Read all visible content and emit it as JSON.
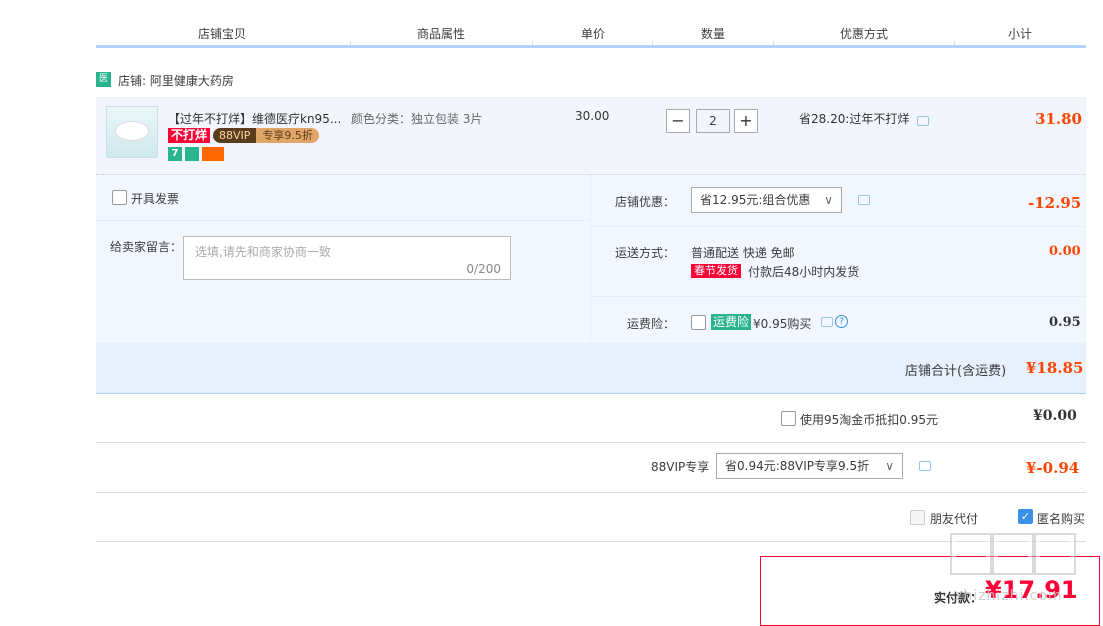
{
  "table_header": {
    "columns": [
      "店铺宝贝",
      "商品属性",
      "单价",
      "数量",
      "优惠方式",
      "小计"
    ]
  },
  "shop": {
    "icon_text": "医",
    "label": "店铺:",
    "name": "阿里健康大药房"
  },
  "item": {
    "title": "【过年不打烊】维德医疗kn95...",
    "badge_not_closed": "不打烊",
    "badge_vip": "88VIP",
    "badge_vip_discount": "专享9.5折",
    "attribute": "颜色分类：独立包装 3片",
    "unit_price": "30.00",
    "quantity": "2",
    "discount_text": "省28.20:过年不打烊",
    "subtotal": "31.80"
  },
  "invoice": {
    "label": "开具发票"
  },
  "message": {
    "label": "给卖家留言：",
    "placeholder": "选填,请先和商家协商一致",
    "counter": "0/200"
  },
  "shop_discount": {
    "label": "店铺优惠：",
    "value": "省12.95元:组合优惠",
    "amount": "-12.95"
  },
  "shipping": {
    "label": "运送方式：",
    "value": "普通配送 快递 免邮",
    "tag": "春节发货",
    "note": "付款后48小时内发货",
    "amount": "0.00"
  },
  "insurance": {
    "label": "运费险：",
    "tag": "运费险",
    "value": "¥0.95购买",
    "amount": "0.95"
  },
  "shop_total": {
    "label": "店铺合计(含运费)",
    "amount": "¥18.85"
  },
  "coins": {
    "label": "使用95淘金币抵扣0.95元",
    "amount": "¥0.00"
  },
  "vip": {
    "label": "88VIP专享",
    "value": "省0.94元:88VIP专享9.5折",
    "amount": "¥-0.94"
  },
  "options": {
    "friend_pay": "朋友代付",
    "anonymous": "匿名购买"
  },
  "total": {
    "label": "实付款：",
    "amount": "¥17.91"
  },
  "watermark": {
    "text": "zhizhizhi.com"
  },
  "colors": {
    "accent_red": "#ff0036",
    "header_line": "#b2d1ff",
    "panel_bg": "#f2f7ff"
  }
}
